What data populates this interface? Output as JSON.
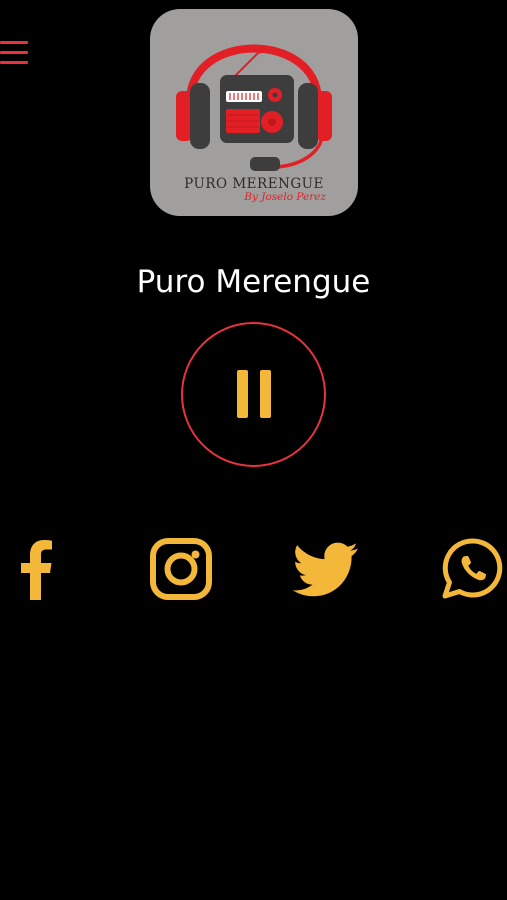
{
  "app": {
    "station_name": "Puro Merengue"
  },
  "logo": {
    "title": "PURO MERENGUE",
    "subtitle": "By Joselo Perez"
  },
  "player": {
    "state": "playing",
    "control_icon": "pause-icon"
  },
  "menu": {
    "icon": "hamburger-menu-icon"
  },
  "social": [
    {
      "network": "Facebook",
      "icon": "facebook-icon"
    },
    {
      "network": "Instagram",
      "icon": "instagram-icon"
    },
    {
      "network": "Twitter",
      "icon": "twitter-icon"
    },
    {
      "network": "WhatsApp",
      "icon": "whatsapp-icon"
    }
  ],
  "colors": {
    "background": "#000000",
    "accent_red": "#e8333f",
    "icon_yellow": "#f3b73a",
    "text": "#ffffff",
    "logo_background": "#a19e9e"
  }
}
